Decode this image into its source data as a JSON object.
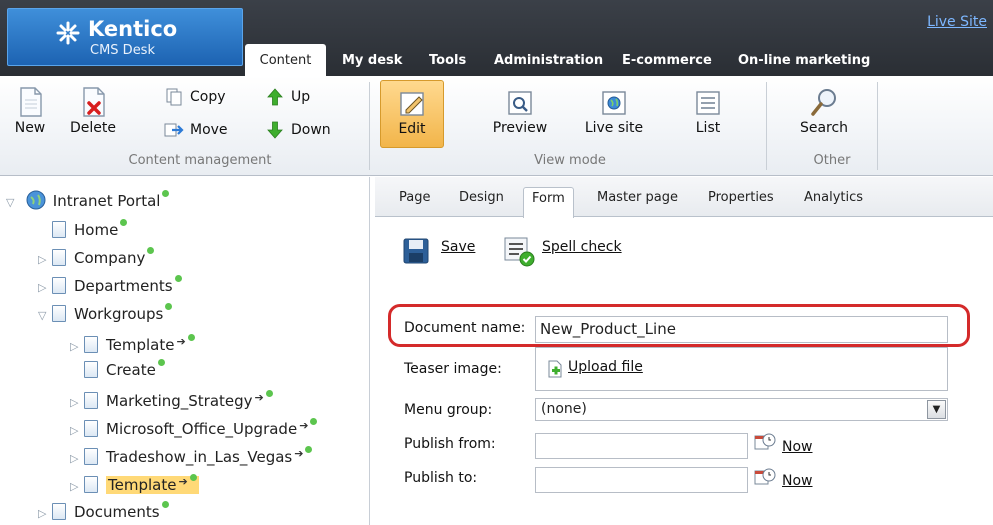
{
  "header": {
    "logo": {
      "brand": "Kentico",
      "sub": "CMS Desk"
    },
    "live_site_link": "Live Site",
    "tabs": [
      {
        "label": "Content",
        "active": true
      },
      {
        "label": "My desk"
      },
      {
        "label": "Tools"
      },
      {
        "label": "Administration"
      },
      {
        "label": "E-commerce"
      },
      {
        "label": "On-line marketing"
      }
    ]
  },
  "ribbon": {
    "content_management": {
      "label": "Content management",
      "new": "New",
      "delete": "Delete",
      "copy": "Copy",
      "move": "Move",
      "up": "Up",
      "down": "Down"
    },
    "view_mode": {
      "label": "View mode",
      "edit": "Edit",
      "preview": "Preview",
      "live_site": "Live site",
      "list": "List",
      "active": "Edit"
    },
    "other": {
      "label": "Other",
      "search": "Search"
    }
  },
  "tree": {
    "root": "Intranet Portal",
    "home": "Home",
    "company": "Company",
    "departments": "Departments",
    "workgroups": "Workgroups",
    "template1": "Template",
    "create": "Create",
    "marketing": "Marketing_Strategy",
    "office": "Microsoft_Office_Upgrade",
    "tradeshow": "Tradeshow_in_Las_Vegas",
    "template2": "Template",
    "documents": "Documents",
    "selected": "Template"
  },
  "form_tabs": [
    {
      "label": "Page"
    },
    {
      "label": "Design"
    },
    {
      "label": "Form",
      "active": true
    },
    {
      "label": "Master page"
    },
    {
      "label": "Properties"
    },
    {
      "label": "Analytics"
    }
  ],
  "actions": {
    "save": "Save",
    "spell_check": "Spell check"
  },
  "form": {
    "document_name": {
      "label": "Document name:",
      "value": "New_Product_Line"
    },
    "teaser_image": {
      "label": "Teaser image:",
      "upload": "Upload file"
    },
    "menu_group": {
      "label": "Menu group:",
      "value": "(none)"
    },
    "publish_from": {
      "label": "Publish from:",
      "value": "",
      "now": "Now"
    },
    "publish_to": {
      "label": "Publish to:",
      "value": "",
      "now": "Now"
    }
  },
  "colors": {
    "highlight": "#d42a2a",
    "selected_node": "#ffd977",
    "active_ribbon": "#f2b54a",
    "status_dot": "#5cc54e"
  }
}
